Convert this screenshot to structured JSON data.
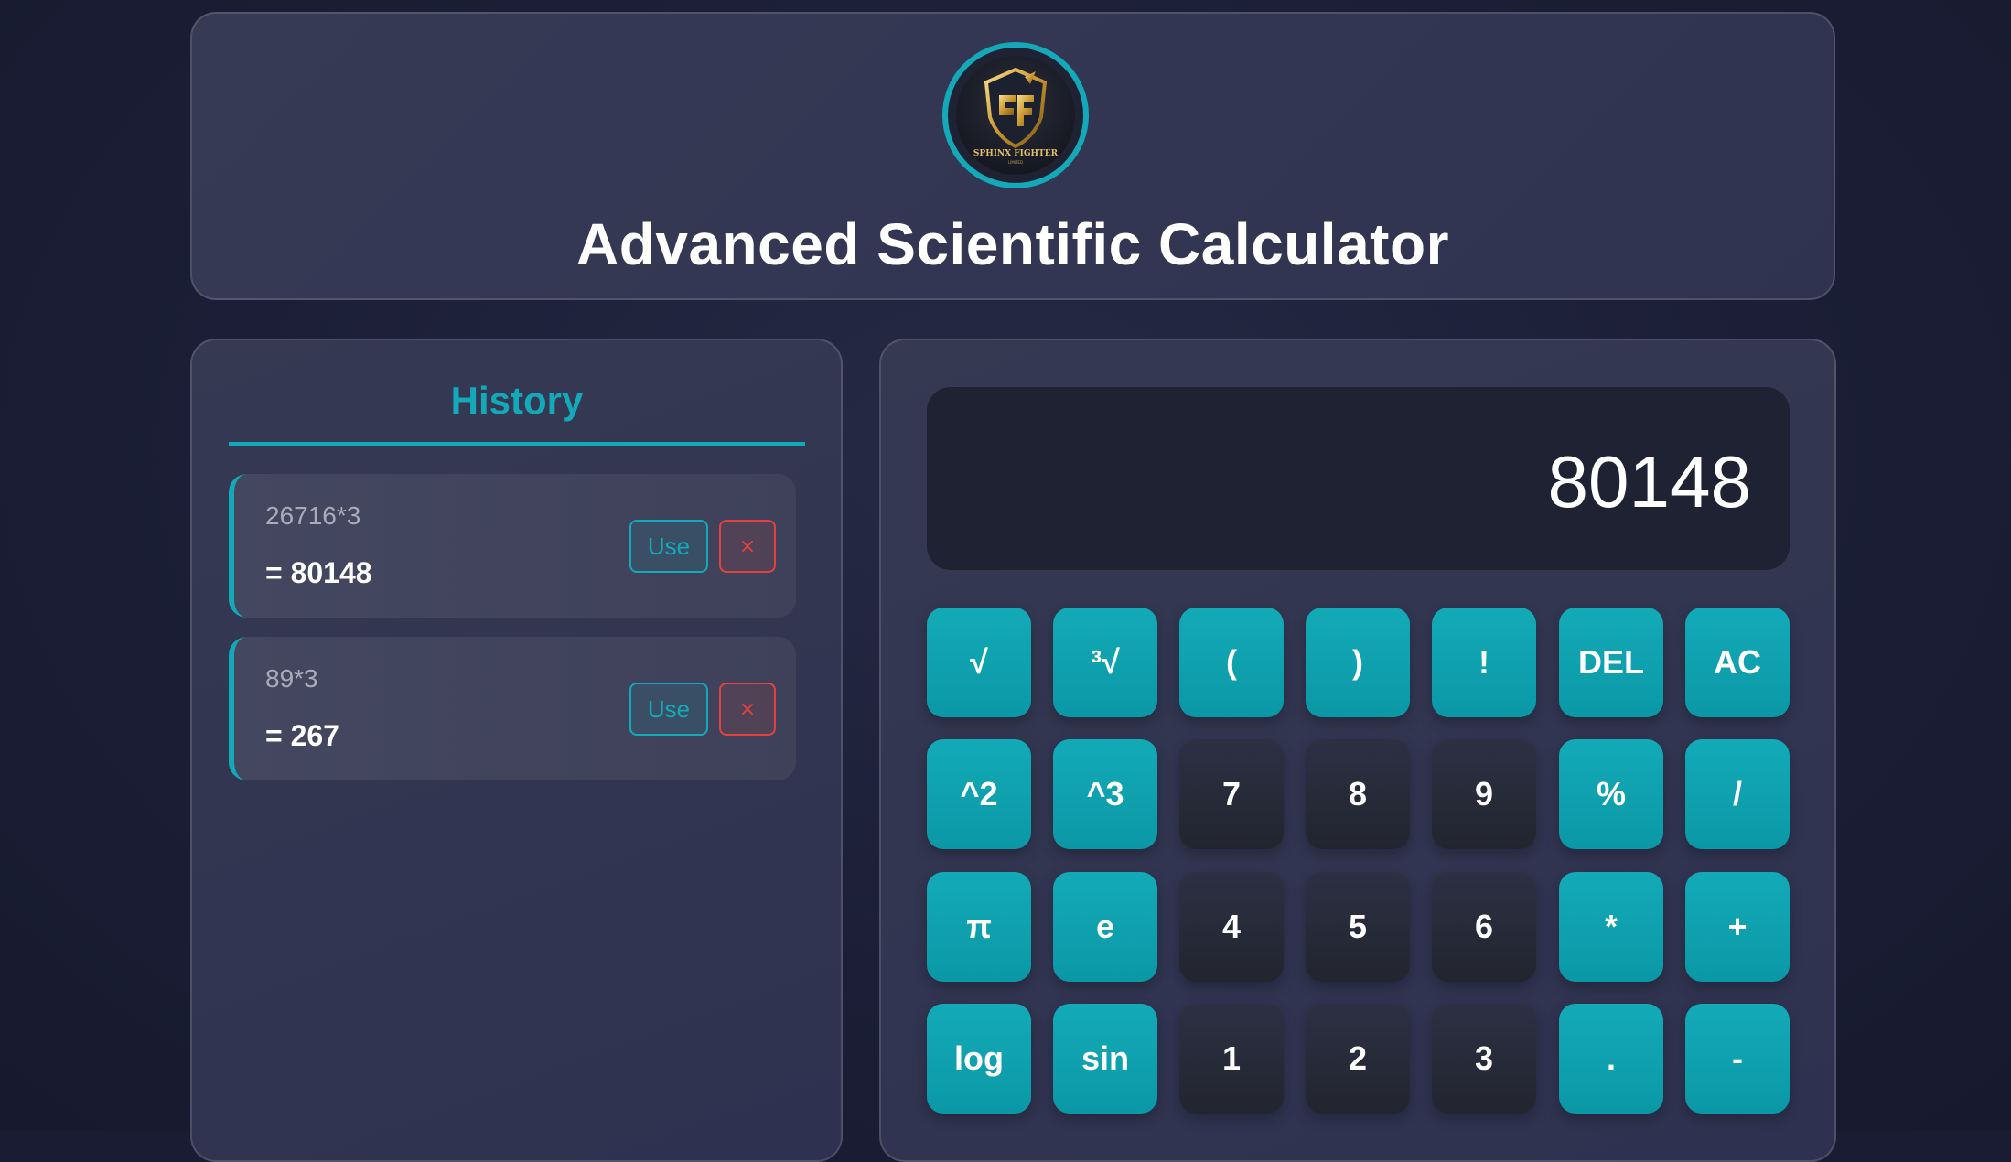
{
  "header": {
    "title": "Advanced Scientific Calculator",
    "logo": {
      "name": "sphinx-fighter-logo",
      "text": "SPHINX FIGHTER",
      "monogram": "SF"
    },
    "accent_color": "#13a9b8"
  },
  "history": {
    "title": "History",
    "items": [
      {
        "expression": "26716*3",
        "result": "= 80148",
        "use_label": "Use",
        "delete_label": "×"
      },
      {
        "expression": "89*3",
        "result": "= 267",
        "use_label": "Use",
        "delete_label": "×"
      }
    ]
  },
  "calculator": {
    "display_value": "80148",
    "keys": [
      [
        "√",
        "³√",
        "(",
        ")",
        "!",
        "DEL",
        "AC"
      ],
      [
        "^2",
        "^3",
        "7",
        "8",
        "9",
        "%",
        "/"
      ],
      [
        "π",
        "e",
        "4",
        "5",
        "6",
        "*",
        "+"
      ],
      [
        "log",
        "sin",
        "1",
        "2",
        "3",
        ".",
        "-"
      ]
    ],
    "colors": {
      "operator_key": "#13a9b8",
      "number_key": "#272a38",
      "delete_button": "#e0433f"
    }
  }
}
